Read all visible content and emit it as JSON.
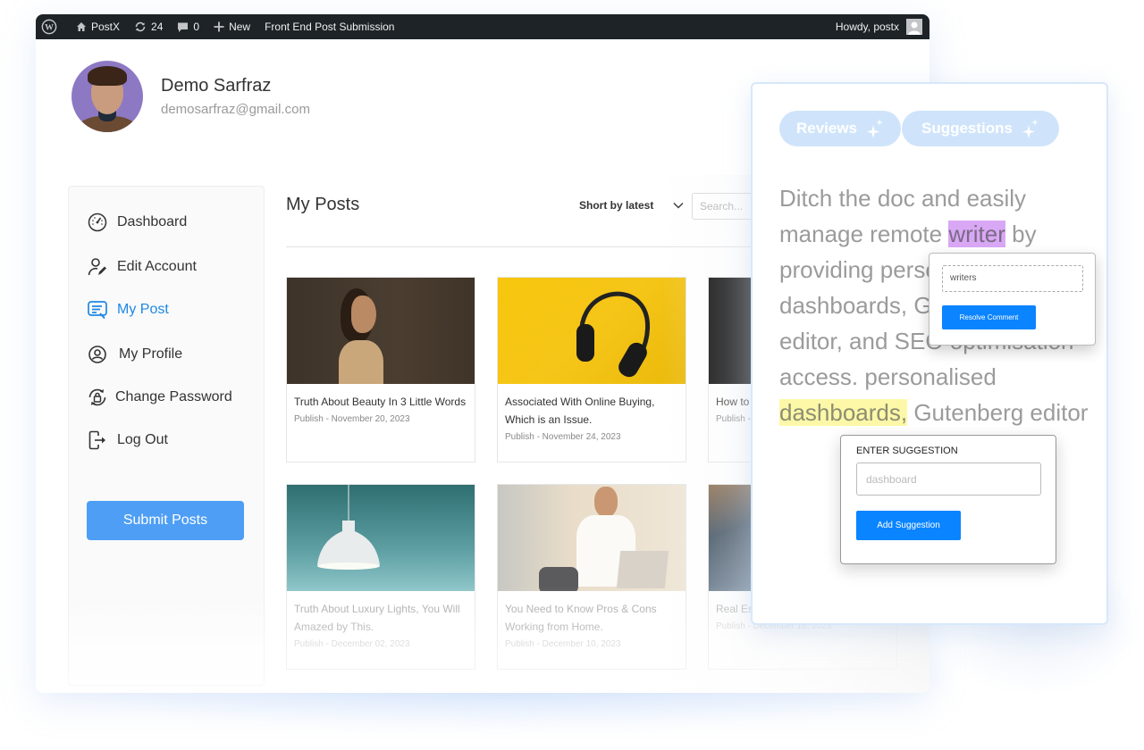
{
  "adminbar": {
    "site_name": "PostX",
    "updates_count": "24",
    "comments_count": "0",
    "new_label": "New",
    "page_link": "Front End Post Submission",
    "greeting": "Howdy, postx"
  },
  "profile": {
    "name": "Demo Sarfraz",
    "email": "demosarfraz@gmail.com"
  },
  "sidebar": {
    "items": [
      {
        "label": "Dashboard",
        "icon": "dashboard-gauge-icon",
        "active": false
      },
      {
        "label": "Edit Account",
        "icon": "user-edit-icon",
        "active": false
      },
      {
        "label": "My Post",
        "icon": "post-list-icon",
        "active": true
      },
      {
        "label": "My Profile",
        "icon": "user-circle-icon",
        "active": false
      },
      {
        "label": "Change Password",
        "icon": "lock-refresh-icon",
        "active": false
      },
      {
        "label": "Log Out",
        "icon": "logout-icon",
        "active": false
      }
    ],
    "submit_label": "Submit Posts"
  },
  "main": {
    "title": "My Posts",
    "sort_label": "Short by latest",
    "search_placeholder": "Search...",
    "posts": [
      {
        "title": "Truth About Beauty In 3 Little Words",
        "date": "Publish - November 20, 2023",
        "image": "woman-portrait"
      },
      {
        "title": "Associated With Online Buying, Which is an Issue.",
        "date": "Publish - November 24, 2023",
        "image": "headphones-yellow"
      },
      {
        "title": "How to ... Designe...",
        "date": "Publish - ...",
        "image": "dark-photo"
      },
      {
        "title": "Truth About Luxury Lights, You Will Amazed by This.",
        "date": "Publish - December 02, 2023",
        "image": "pendant-lamp"
      },
      {
        "title": "You Need to Know Pros & Cons Working from Home.",
        "date": "Publish - December 10, 2023",
        "image": "man-on-phone"
      },
      {
        "title": "Real Est... Growing Business.",
        "date": "Publish - December 16, 2023",
        "image": "building"
      }
    ]
  },
  "panel": {
    "tabs": [
      {
        "label": "Reviews",
        "icon": "sparkle-icon"
      },
      {
        "label": "Suggestions",
        "icon": "sparkle-icon"
      }
    ],
    "text_parts": {
      "p1": "Ditch the doc and easily manage remote ",
      "highlight_comment": "writer",
      "p2": " by providing personalised dashboards, Gutenberg editor, and SEO optimisation access. personalised ",
      "highlight_suggestion": "dashboards,",
      "p3": " Gutenberg editor"
    },
    "comment_popup": {
      "input_value": "writers",
      "button_label": "Resolve Comment"
    },
    "suggestion_popup": {
      "label": "ENTER SUGGESTION",
      "input_placeholder": "dashboard",
      "button_label": "Add Suggestion"
    }
  },
  "colors": {
    "accent": "#1e88e5",
    "submit_button": "#4e9ef5",
    "popup_button": "#0a84ff",
    "adminbar_bg": "#1d2327",
    "highlight_comment": "#d9a8f5",
    "highlight_suggestion": "#fcf8a8",
    "pill_bg": "#cfe4fb"
  }
}
